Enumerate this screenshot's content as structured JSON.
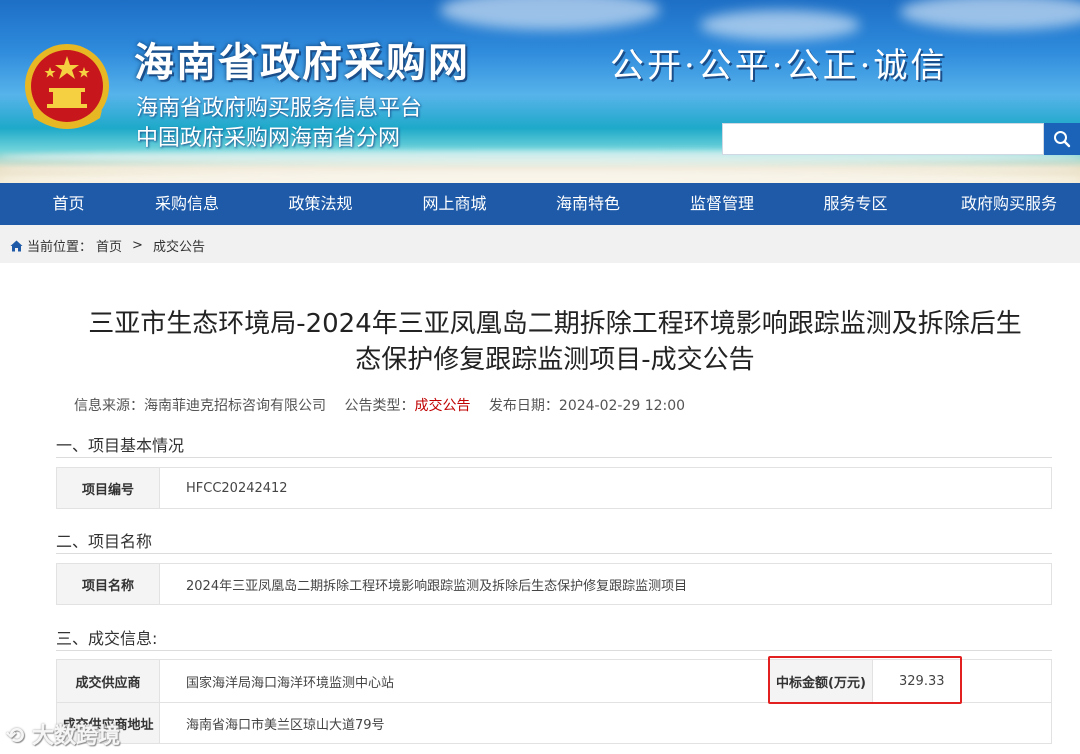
{
  "header": {
    "site_title": "海南省政府采购网",
    "subtitle_1": "海南省政府购买服务信息平台",
    "subtitle_2": "中国政府采购网海南省分网",
    "slogan": "公开·公平·公正·诚信",
    "search": {
      "placeholder": "",
      "icon": "search-icon"
    }
  },
  "nav": {
    "items": [
      {
        "label": "首页"
      },
      {
        "label": "采购信息"
      },
      {
        "label": "政策法规"
      },
      {
        "label": "网上商城"
      },
      {
        "label": "海南特色"
      },
      {
        "label": "监督管理"
      },
      {
        "label": "服务专区"
      },
      {
        "label": "政府购买服务"
      }
    ]
  },
  "breadcrumb": {
    "prefix": "当前位置：",
    "home": "首页",
    "separator": ">",
    "current": "成交公告"
  },
  "article": {
    "title_line1": "三亚市生态环境局-2024年三亚凤凰岛二期拆除工程环境影响跟踪监测及拆除后生",
    "title_line2": "态保护修复跟踪监测项目-成交公告",
    "meta": {
      "source_label": "信息来源：",
      "source_value": "海南菲迪克招标咨询有限公司",
      "type_label": "公告类型：",
      "type_value": "成交公告",
      "date_label": "发布日期：",
      "date_value": "2024-02-29 12:00"
    },
    "section1": {
      "heading": "一、项目基本情况",
      "label": "项目编号",
      "value": "HFCC20242412"
    },
    "section2": {
      "heading": "二、项目名称",
      "label": "项目名称",
      "value": "2024年三亚凤凰岛二期拆除工程环境影响跟踪监测及拆除后生态保护修复跟踪监测项目"
    },
    "section3": {
      "heading": "三、成交信息:",
      "supplier_label": "成交供应商",
      "supplier_value": "国家海洋局海口海洋环境监测中心站",
      "amount_label": "中标金额(万元)",
      "amount_value": "329.33",
      "address_label": "成交供应商地址",
      "address_value": "海南省海口市美兰区琼山大道79号"
    }
  },
  "watermark": "大数跨境",
  "colors": {
    "nav_bg": "#1e5aa8",
    "highlight_red": "#c00000",
    "box_red": "#e32020"
  }
}
